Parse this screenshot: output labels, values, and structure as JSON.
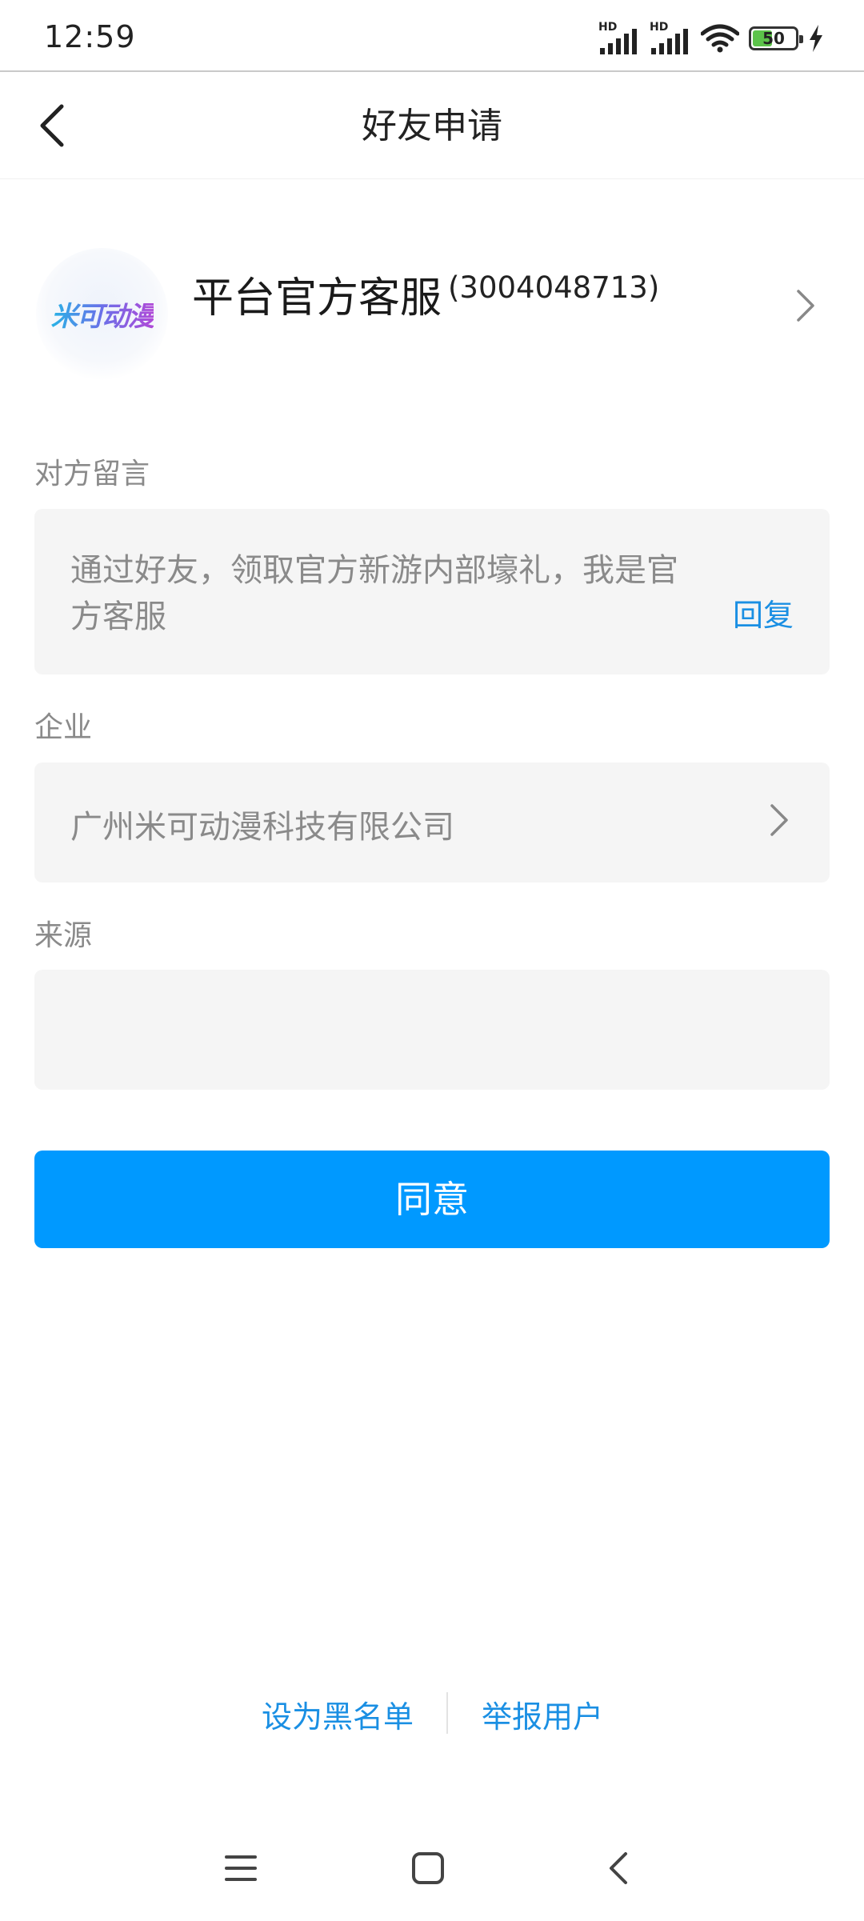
{
  "status_bar": {
    "time": "12:59",
    "signal_1_label": "HD",
    "signal_2_label": "HD",
    "battery_level": "50",
    "battery_fraction": 0.5
  },
  "nav": {
    "title": "好友申请",
    "back_icon": "chevron-left-icon"
  },
  "profile": {
    "avatar_logo_text": "米可动漫",
    "name": "平台官方客服",
    "id": "(3004048713)",
    "chevron_icon": "chevron-right-icon"
  },
  "message_section": {
    "label": "对方留言",
    "text": "通过好友，领取官方新游内部壕礼，我是官方客服",
    "reply_label": "回复"
  },
  "company_section": {
    "label": "企业",
    "value": "广州米可动漫科技有限公司"
  },
  "source_section": {
    "label": "来源",
    "value": ""
  },
  "agree_button": {
    "label": "同意"
  },
  "bottom_links": {
    "blacklist_label": "设为黑名单",
    "report_label": "举报用户"
  },
  "colors": {
    "accent": "#0099ff",
    "link": "#1a8fe3",
    "box_bg": "#f5f5f5",
    "muted_text": "#8a8a8a"
  }
}
